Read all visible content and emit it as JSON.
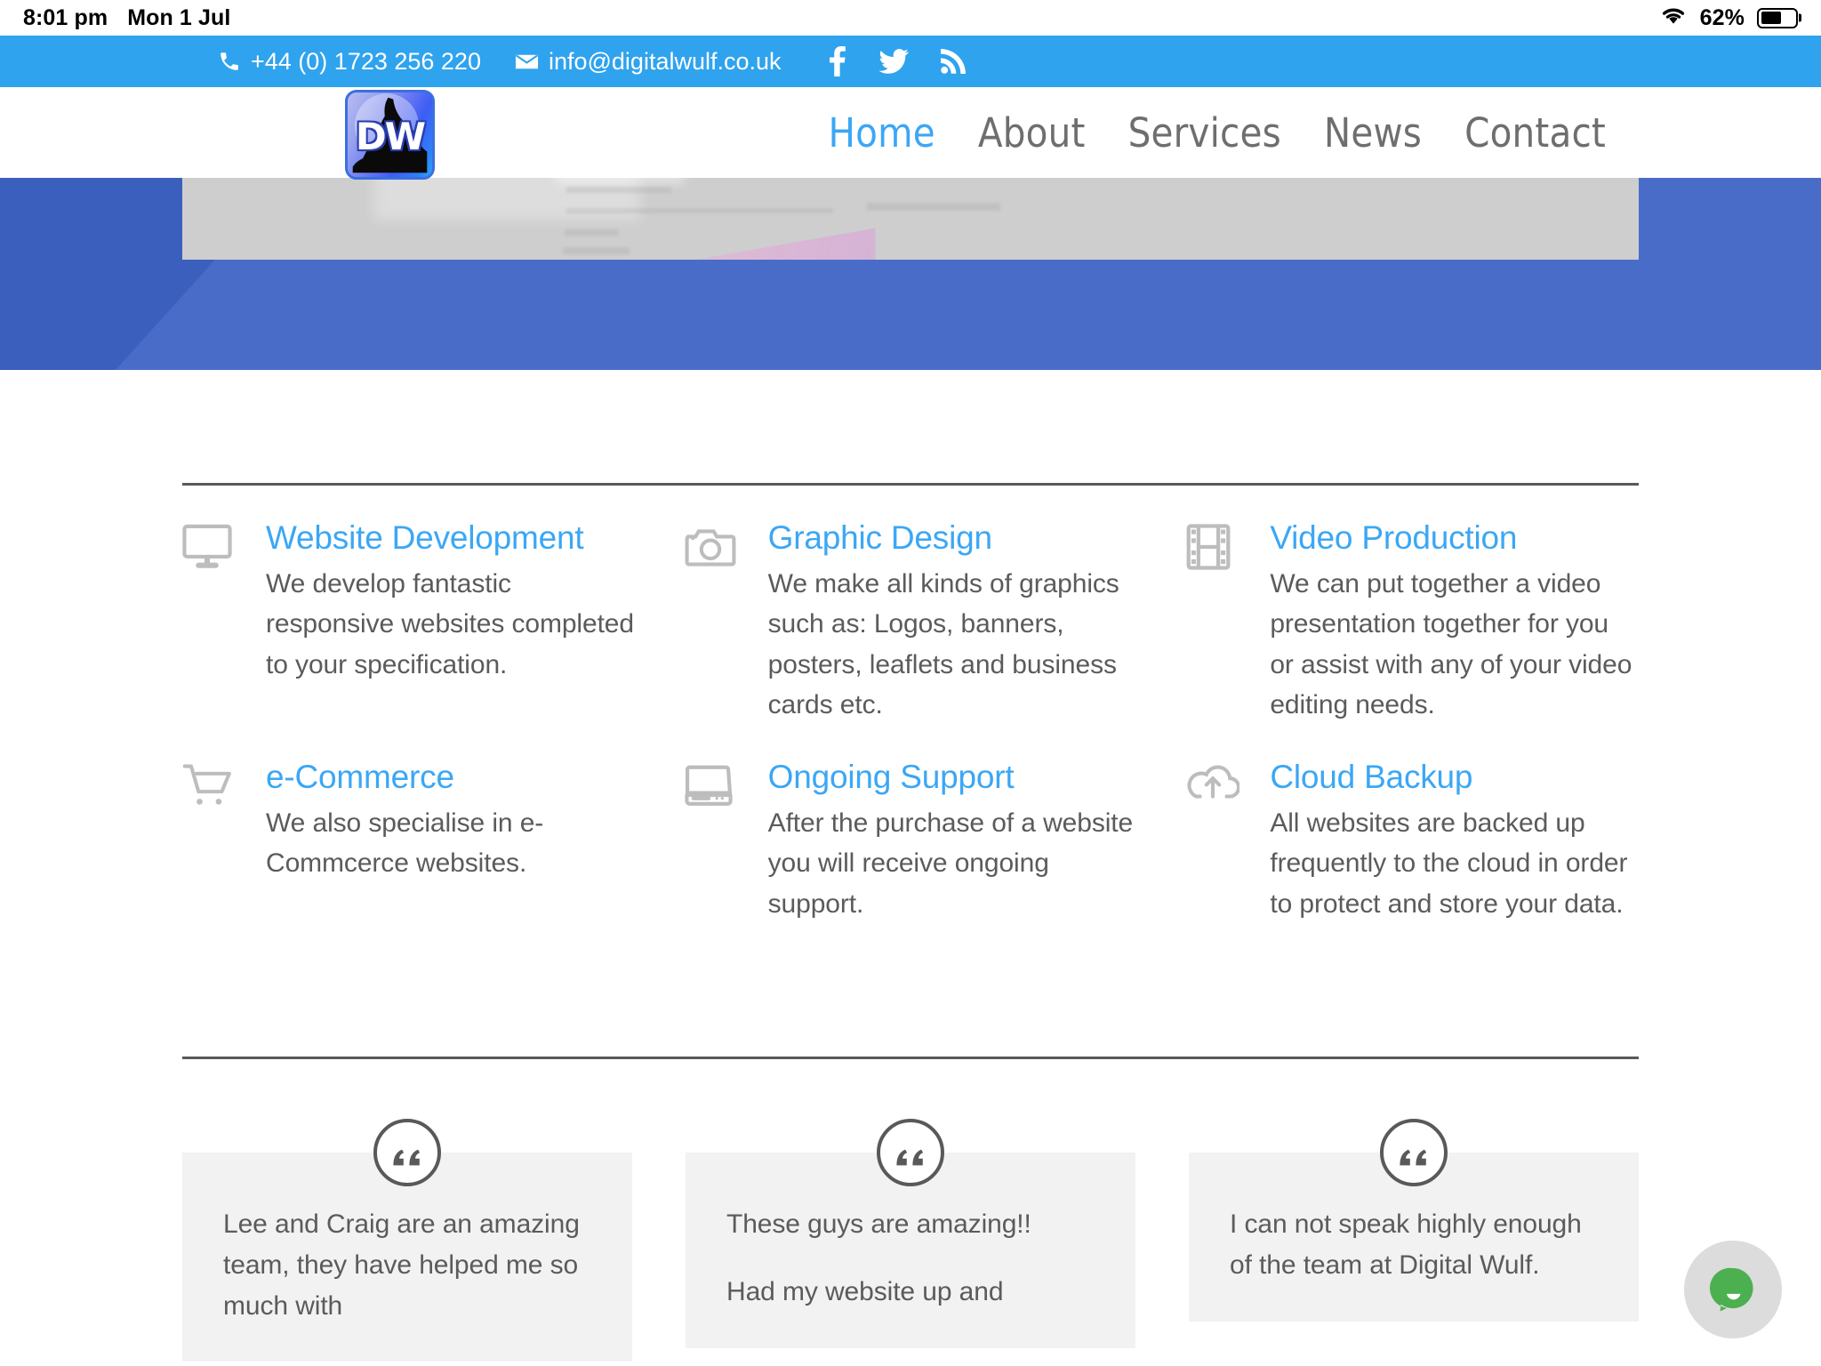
{
  "status_bar": {
    "time": "8:01 pm",
    "date": "Mon 1 Jul",
    "battery_percent": "62%",
    "wifi_icon": "wifi-icon",
    "battery_icon": "battery-icon"
  },
  "topbar": {
    "phone": "+44 (0) 1723 256 220",
    "email": "info@digitalwulf.co.uk",
    "phone_icon": "phone-icon",
    "email_icon": "envelope-icon",
    "background_color": "#2fa3ee",
    "social": [
      {
        "name": "facebook-icon",
        "label": "Facebook"
      },
      {
        "name": "twitter-icon",
        "label": "Twitter"
      },
      {
        "name": "rss-icon",
        "label": "RSS"
      }
    ]
  },
  "header": {
    "logo_text": "DW",
    "logo_alt": "Digital Wulf logo",
    "nav": [
      {
        "label": "Home",
        "active": true
      },
      {
        "label": "About",
        "active": false
      },
      {
        "label": "Services",
        "active": false
      },
      {
        "label": "News",
        "active": false
      },
      {
        "label": "Contact",
        "active": false
      }
    ],
    "accent_color": "#3ba7f5",
    "nav_color": "#6e6e6e"
  },
  "hero": {
    "background_color": "#3b5fbd",
    "diagonal_color": "#4a6cc9",
    "screenshot_placeholder_color": "#cecece"
  },
  "services": [
    {
      "icon": "monitor-icon",
      "title": "Website Development",
      "text": "We develop fantastic responsive websites completed to your specification."
    },
    {
      "icon": "camera-icon",
      "title": "Graphic Design",
      "text": "We make all kinds of graphics such as: Logos, banners, posters, leaflets and business cards etc."
    },
    {
      "icon": "film-strip-icon",
      "title": "Video Production",
      "text": "We can put together a video presentation together for you or assist with any of your video editing needs."
    },
    {
      "icon": "shopping-cart-icon",
      "title": "e-Commerce",
      "text": "We also specialise in e-Commcerce websites."
    },
    {
      "icon": "hard-drive-icon",
      "title": "Ongoing Support",
      "text": "After the purchase of a website you will receive ongoing support."
    },
    {
      "icon": "cloud-upload-icon",
      "title": "Cloud Backup",
      "text": "All websites are backed up frequently to the cloud in order to protect and store your data."
    }
  ],
  "testimonials": [
    {
      "quote_icon": "quote-icon",
      "paragraphs": [
        "Lee and Craig are an amazing team, they have helped me so much with"
      ]
    },
    {
      "quote_icon": "quote-icon",
      "paragraphs": [
        "These guys are amazing!!",
        "Had my website up and"
      ]
    },
    {
      "quote_icon": "quote-icon",
      "paragraphs": [
        "I can not speak highly enough of the team at Digital Wulf."
      ]
    }
  ],
  "chat_widget": {
    "icon": "chat-bubble-icon",
    "label": "Open chat",
    "color": "#4caf50"
  },
  "colors": {
    "brand_blue": "#3ba7f5",
    "topbar_blue": "#2fa3ee",
    "body_text": "#5b5b5b",
    "divider": "#595959",
    "card_bg": "#f2f2f2"
  }
}
